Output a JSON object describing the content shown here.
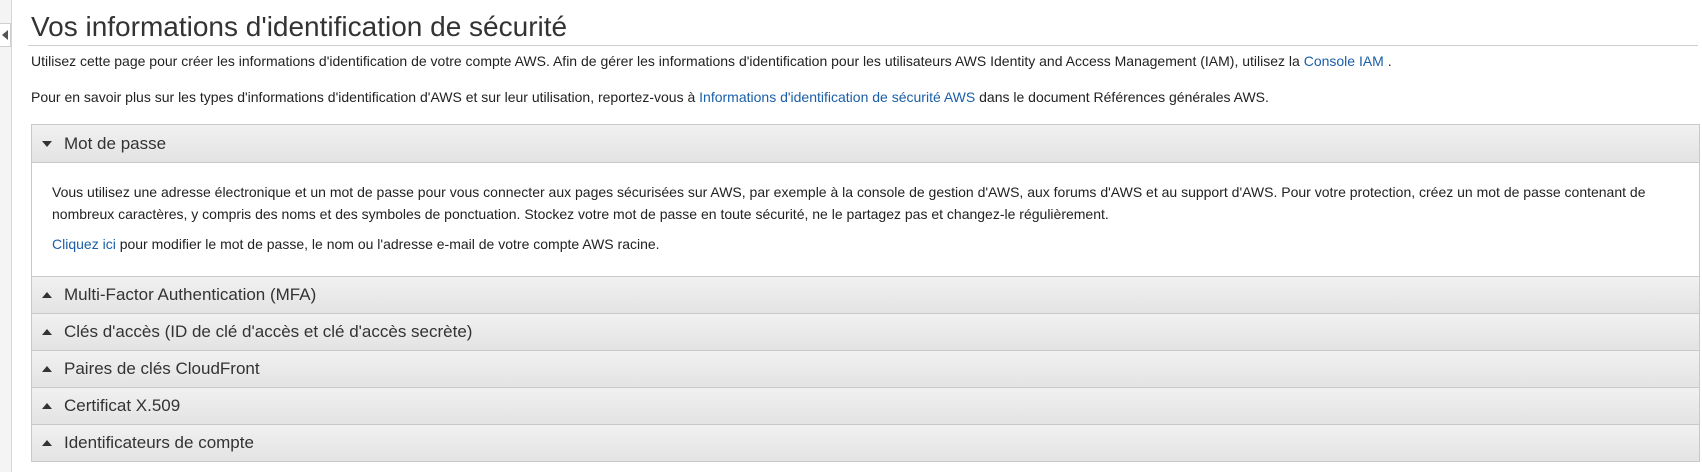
{
  "page": {
    "title": "Vos informations d'identification de sécurité",
    "intro1": {
      "text": "Utilisez cette page pour créer les informations d'identification de votre compte AWS. Afin de gérer les informations d'identification pour les utilisateurs AWS Identity and Access Management (IAM), utilisez la ",
      "link": "Console IAM",
      "after": " ."
    },
    "intro2": {
      "text": "Pour en savoir plus sur les types d'informations d'identification d'AWS et sur leur utilisation, reportez-vous à ",
      "link": "Informations d'identification de sécurité AWS",
      "after": " dans le document Références générales AWS."
    }
  },
  "sections": {
    "password": {
      "label": "Mot de passe",
      "expanded": true,
      "body1": "Vous utilisez une adresse électronique et un mot de passe pour vous connecter aux pages sécurisées sur AWS, par exemple à la console de gestion d'AWS, aux forums d'AWS et au support d'AWS. Pour votre protection, créez un mot de passe contenant de nombreux caractères, y compris des noms et des symboles de ponctuation. Stockez votre mot de passe en toute sécurité, ne le partagez pas et changez-le régulièrement.",
      "link": "Cliquez ici",
      "link_after": " pour modifier le mot de passe, le nom ou l'adresse e-mail de votre compte AWS racine."
    },
    "mfa": {
      "label": "Multi-Factor Authentication (MFA)",
      "expanded": false
    },
    "access_keys": {
      "label": "Clés d'accès (ID de clé d'accès et clé d'accès secrète)",
      "expanded": false
    },
    "cloudfront": {
      "label": "Paires de clés CloudFront",
      "expanded": false
    },
    "x509": {
      "label": "Certificat X.509",
      "expanded": false
    },
    "account_ids": {
      "label": "Identificateurs de compte",
      "expanded": false
    }
  },
  "icons": {
    "collapse_handle": "triangle-left-icon",
    "expanded": "caret-down-icon",
    "collapsed": "caret-up-icon"
  },
  "colors": {
    "link": "#1a5fa8",
    "header_bg": "#e8e8e8",
    "border": "#c9c9c9"
  }
}
